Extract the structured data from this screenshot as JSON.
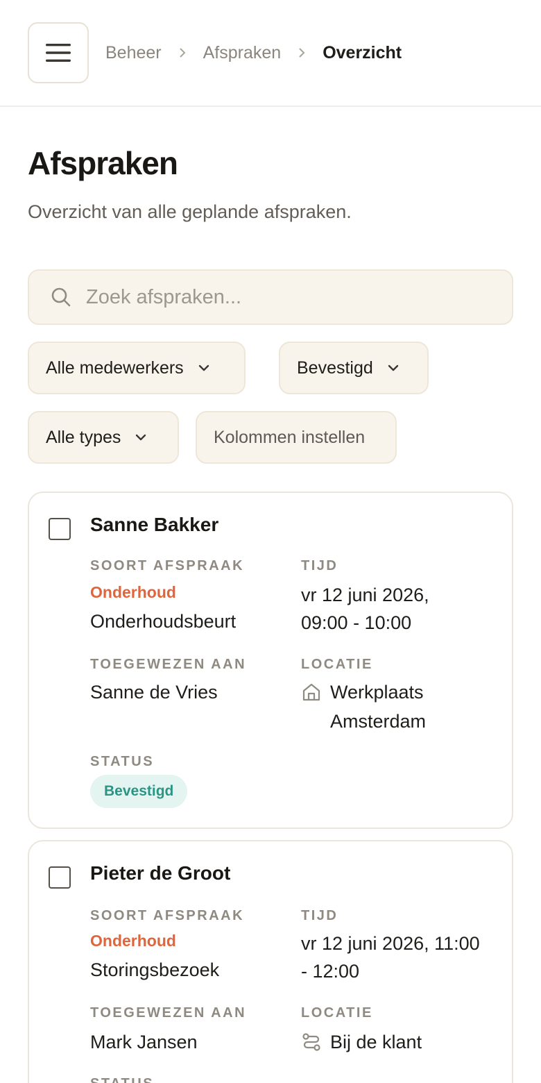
{
  "breadcrumb": {
    "items": [
      "Beheer",
      "Afspraken"
    ],
    "current": "Overzicht"
  },
  "page": {
    "title": "Afspraken",
    "subtitle": "Overzicht van alle geplande afspraken."
  },
  "search": {
    "placeholder": "Zoek afspraken..."
  },
  "filters": {
    "staff": "Alle medewerkers",
    "status": "Bevestigd",
    "types": "Alle types",
    "columns": "Kolommen instellen"
  },
  "labels": {
    "type": "SOORT AFSPRAAK",
    "time": "TIJD",
    "assigned": "TOEGEWEZEN AAN",
    "location": "LOCATIE",
    "status": "STATUS"
  },
  "appointments": [
    {
      "name": "Sanne Bakker",
      "category": "Onderhoud",
      "type": "Onderhoudsbeurt",
      "time_line1": "vr 12 juni 2026,",
      "time_line2": "09:00 - 10:00",
      "assigned": "Sanne de Vries",
      "location_line1": "Werkplaats",
      "location_line2": "Amsterdam",
      "location_icon": "home-icon",
      "status": "Bevestigd"
    },
    {
      "name": "Pieter de Groot",
      "category": "Onderhoud",
      "type": "Storingsbezoek",
      "time_line1": "vr 12 juni 2026, 11:00",
      "time_line2": "- 12:00",
      "assigned": "Mark Jansen",
      "location_line1": "Bij de klant",
      "location_icon": "route-icon"
    }
  ],
  "colors": {
    "accent": "#e0643c",
    "badge_bg": "#e4f4f1",
    "badge_text": "#2a9585",
    "field_bg": "#f8f4ec"
  }
}
